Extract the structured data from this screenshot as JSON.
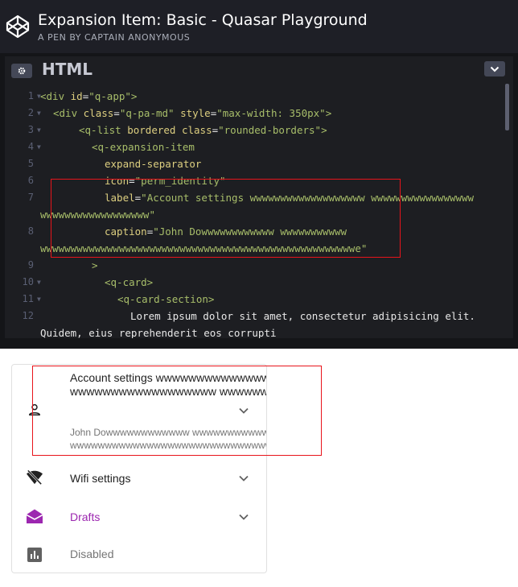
{
  "header": {
    "title": "Expansion Item: Basic - Quasar Playground",
    "subtitle": "A PEN BY CAPTAIN ANONYMOUS"
  },
  "editor": {
    "language": "HTML",
    "line_numbers": [
      "1",
      "2",
      "3",
      "4",
      "5",
      "6",
      "7",
      "",
      "8",
      "",
      "9",
      "10",
      "11",
      "12",
      ""
    ],
    "code": {
      "l1a": "<div ",
      "l1b": "id",
      "l1c": "=",
      "l1d": "\"q-app\"",
      "l1e": ">",
      "l2a": "<div ",
      "l2b": "class",
      "l2c": "=",
      "l2d": "\"q-pa-md\"",
      "l2e": " style",
      "l2f": "=",
      "l2g": "\"max-width: 350px\"",
      "l2h": ">",
      "l3a": "<q-list ",
      "l3b": "bordered",
      "l3c": " class",
      "l3d": "=",
      "l3e": "\"rounded-borders\"",
      "l3f": ">",
      "l4a": "<q-expansion-item",
      "l5a": "expand-separator",
      "l6a": "icon",
      "l6b": "=",
      "l6c": "\"perm_identity\"",
      "l7a": "label",
      "l7b": "=",
      "l7c": "\"Account settings wwwwwwwwwwwwwwwwwww wwwwwwwwwwwwwwwww",
      "l7d": "wwwwwwwwwwwwwwwwww\"",
      "l8a": "caption",
      "l8b": "=",
      "l8c": "\"John Dowwwwwwwwwwww wwwwwwwwwww",
      "l8d": "wwwwwwwwwwwwwwwwwwwwwwwwwwwwwwwwwwwwwwwwwwwwwwwwwwwwe\"",
      "l9a": ">",
      "l10a": "<q-card>",
      "l11a": "<q-card-section>",
      "l12a": "Lorem ipsum dolor sit amet, consectetur adipisicing elit.",
      "l12b": "Quidem, eius reprehenderit eos corrupti"
    }
  },
  "preview": {
    "items": [
      {
        "label": "Account settings wwwwwwwwwwwwwwwwwww",
        "label2": "wwwwwwwwwwwwwwwwww wwwwwwwwwwwwwwwww",
        "caption": "John Dowwwwwwwwwwww wwwwwwwwwww",
        "caption2": "wwwwwwwwwwwwwwwwwwwwwwwwwwwwwwwwwwwwwwwwwwwwwwwwwwwwe",
        "icon": "person-outline-icon"
      },
      {
        "label": "Wifi settings",
        "icon": "wifi-off-icon"
      },
      {
        "label": "Drafts",
        "icon": "drafts-icon",
        "color": "#9c27b0"
      },
      {
        "label": "Disabled",
        "icon": "bar-chart-icon"
      }
    ]
  },
  "colors": {
    "accent": "#9c27b0",
    "highlight": "#e8141b",
    "header_bg": "#1e1f26",
    "editor_bg": "#1d1e22"
  }
}
